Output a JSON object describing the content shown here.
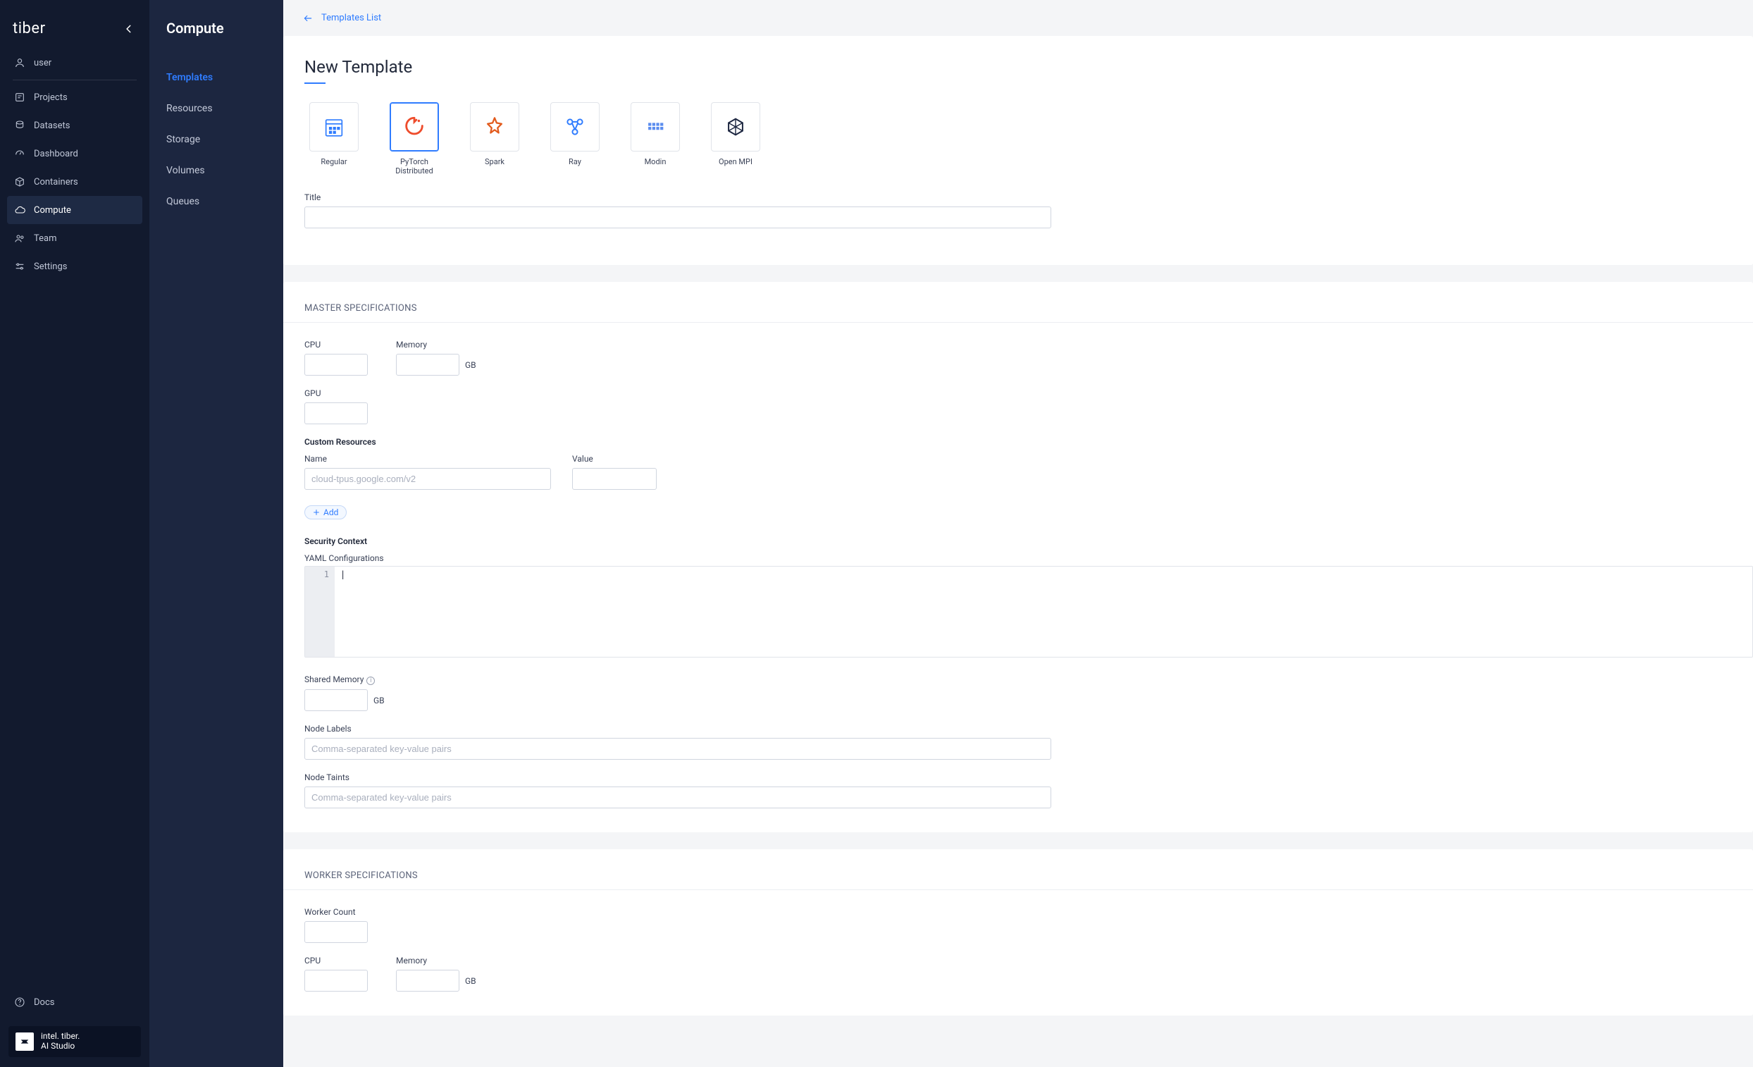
{
  "primarySidebar": {
    "brand": "tiber",
    "items": [
      {
        "key": "user",
        "label": "user"
      },
      {
        "key": "projects",
        "label": "Projects"
      },
      {
        "key": "datasets",
        "label": "Datasets"
      },
      {
        "key": "dashboard",
        "label": "Dashboard"
      },
      {
        "key": "containers",
        "label": "Containers"
      },
      {
        "key": "compute",
        "label": "Compute"
      },
      {
        "key": "team",
        "label": "Team"
      },
      {
        "key": "settings",
        "label": "Settings"
      }
    ],
    "activeKey": "compute",
    "docsLabel": "Docs",
    "footerLine1": "intel. tiber.",
    "footerLine2": "AI Studio"
  },
  "secondarySidebar": {
    "title": "Compute",
    "items": [
      {
        "key": "templates",
        "label": "Templates"
      },
      {
        "key": "resources",
        "label": "Resources"
      },
      {
        "key": "storage",
        "label": "Storage"
      },
      {
        "key": "volumes",
        "label": "Volumes"
      },
      {
        "key": "queues",
        "label": "Queues"
      }
    ],
    "activeKey": "templates"
  },
  "breadcrumb": {
    "backTo": "Templates List"
  },
  "page": {
    "title": "New Template",
    "frameworks": [
      {
        "key": "regular",
        "label": "Regular"
      },
      {
        "key": "pytorch",
        "label": "PyTorch Distributed"
      },
      {
        "key": "spark",
        "label": "Spark"
      },
      {
        "key": "ray",
        "label": "Ray"
      },
      {
        "key": "modin",
        "label": "Modin"
      },
      {
        "key": "openmpi",
        "label": "Open MPI"
      }
    ],
    "selectedFramework": "pytorch",
    "titleLabel": "Title",
    "titleValue": ""
  },
  "master": {
    "header": "MASTER SPECIFICATIONS",
    "cpuLabel": "CPU",
    "cpuValue": "",
    "memoryLabel": "Memory",
    "memoryValue": "",
    "memoryUnit": "GB",
    "gpuLabel": "GPU",
    "gpuValue": "",
    "customResourcesHeader": "Custom Resources",
    "customNameLabel": "Name",
    "customNamePlaceholder": "cloud-tpus.google.com/v2",
    "customValueLabel": "Value",
    "addLabel": "Add",
    "securityContextHeader": "Security Context",
    "yamlLabel": "YAML Configurations",
    "yamlLineNumber": "1",
    "yamlContent": "|",
    "sharedMemoryLabel": "Shared Memory",
    "sharedMemoryValue": "",
    "sharedMemoryUnit": "GB",
    "nodeLabelsLabel": "Node Labels",
    "nodeLabelsPlaceholder": "Comma-separated key-value pairs",
    "nodeTaintsLabel": "Node Taints",
    "nodeTaintsPlaceholder": "Comma-separated key-value pairs"
  },
  "worker": {
    "header": "WORKER SPECIFICATIONS",
    "workerCountLabel": "Worker Count",
    "workerCountValue": "",
    "cpuLabel": "CPU",
    "cpuValue": "",
    "memoryLabel": "Memory",
    "memoryValue": "",
    "memoryUnit": "GB"
  }
}
